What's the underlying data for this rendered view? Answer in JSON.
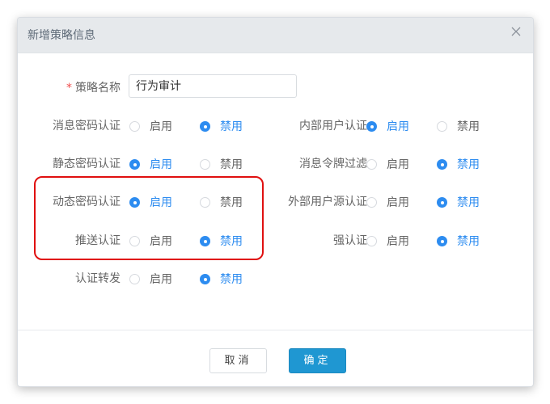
{
  "dialog": {
    "title": "新增策略信息",
    "close_icon": "close-icon"
  },
  "form": {
    "name_field": {
      "required_mark": "*",
      "label": "策略名称",
      "value": "行为审计"
    },
    "options": {
      "enable": "启用",
      "disable": "禁用"
    },
    "left_column": [
      {
        "label": "消息密码认证",
        "selected": "disable"
      },
      {
        "label": "静态密码认证",
        "selected": "enable"
      },
      {
        "label": "动态密码认证",
        "selected": "enable"
      },
      {
        "label": "推送认证",
        "selected": "disable"
      },
      {
        "label": "认证转发",
        "selected": "disable"
      }
    ],
    "right_column": [
      {
        "label": "内部用户认证",
        "selected": "enable"
      },
      {
        "label": "消息令牌过滤",
        "selected": "disable"
      },
      {
        "label": "外部用户源认证",
        "selected": "disable"
      },
      {
        "label": "强认证",
        "selected": "disable"
      }
    ]
  },
  "footer": {
    "cancel_label": "取消",
    "ok_label": "确定"
  },
  "colors": {
    "accent": "#2d8cf0",
    "primary_button": "#1f97d2",
    "highlight_box": "#e01010"
  }
}
